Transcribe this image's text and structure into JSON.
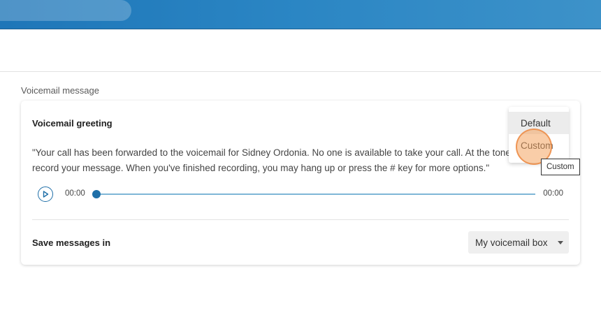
{
  "section": {
    "title": "Voicemail message"
  },
  "greeting": {
    "title": "Voicemail greeting",
    "text_line1": "\"Your call has been forwarded to the voicemail for Sidney Ordonia. No one is available to take your call. At the tone",
    "text_line2": "record your message. When you've finished recording, you may hang up or press the # key for more options.\""
  },
  "player": {
    "current_time": "00:00",
    "duration": "00:00",
    "progress": 0,
    "play_icon": "play-icon"
  },
  "save": {
    "label": "Save messages in",
    "selected": "My voicemail box"
  },
  "dropdown": {
    "items": [
      {
        "label": "Default"
      },
      {
        "label": "Custom"
      }
    ]
  },
  "tooltip": {
    "text": "Custom"
  },
  "colors": {
    "brand": "#1e76b8",
    "accent": "#1f6fa8",
    "click_highlight": "#f4a460"
  }
}
